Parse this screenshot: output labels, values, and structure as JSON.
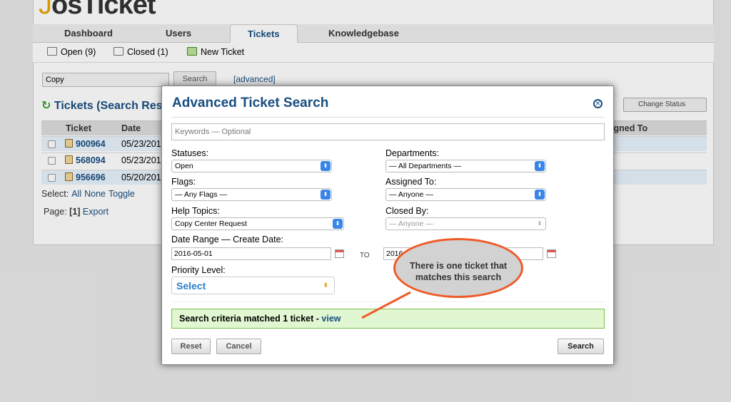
{
  "app": {
    "logo_text": "osTicket",
    "logo_prefix": "J"
  },
  "nav": {
    "tabs": [
      {
        "label": "Dashboard"
      },
      {
        "label": "Users"
      },
      {
        "label": "Tickets"
      },
      {
        "label": "Knowledgebase"
      }
    ]
  },
  "subnav": {
    "open": "Open (9)",
    "closed": "Closed (1)",
    "new_ticket": "New Ticket"
  },
  "search": {
    "value": "Copy",
    "button": "Search",
    "advanced": "[advanced]"
  },
  "tickets": {
    "title": "Tickets (Search Resu",
    "change_status": "Change Status",
    "columns": {
      "ticket": "Ticket",
      "date": "Date",
      "assigned": "igned To"
    },
    "rows": [
      {
        "number": "900964",
        "date": "05/23/201"
      },
      {
        "number": "568094",
        "date": "05/23/201"
      },
      {
        "number": "956696",
        "date": "05/20/201"
      }
    ],
    "select_label": "Select:",
    "select_all": "All",
    "select_none": "None",
    "select_toggle": "Toggle",
    "page_label": "Page:",
    "page_current": "[1]",
    "export": "Export"
  },
  "modal": {
    "title": "Advanced Ticket Search",
    "keywords_placeholder": "Keywords — Optional",
    "statuses_label": "Statuses:",
    "statuses_value": "Open",
    "departments_label": "Departments:",
    "departments_value": "— All Departments —",
    "flags_label": "Flags:",
    "flags_value": "— Any Flags —",
    "assigned_label": "Assigned To:",
    "assigned_value": "— Anyone —",
    "help_label": "Help Topics:",
    "help_value": "Copy Center Request",
    "closed_label": "Closed By:",
    "closed_value": "— Anyone —",
    "date_label": "Date Range — Create Date:",
    "date_from": "2016-05-01",
    "date_to_label": "TO",
    "date_to": "2016",
    "priority_label": "Priority Level:",
    "priority_value": "Select",
    "match_text": "Search criteria matched 1 ticket - ",
    "match_link": "view",
    "reset": "Reset",
    "cancel": "Cancel",
    "search": "Search"
  },
  "callout": {
    "line1": "There is one ticket that",
    "line2": "matches this search"
  },
  "colors": {
    "accent": "#184e81",
    "callout_border": "#f05a28",
    "match_bg": "#e1f7d2"
  }
}
